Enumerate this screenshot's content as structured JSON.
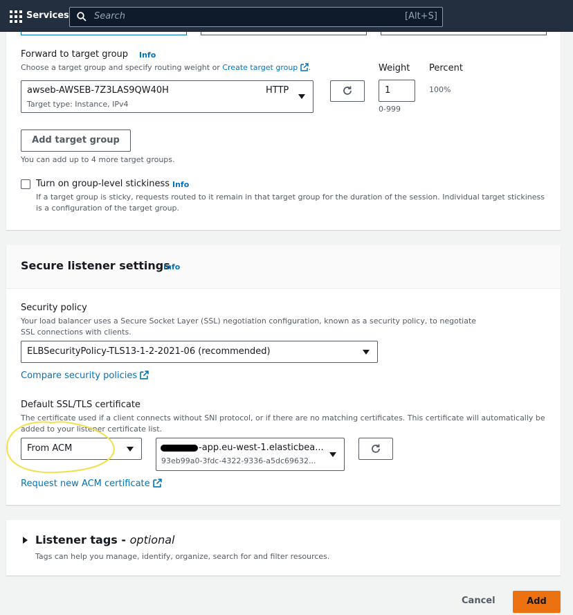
{
  "topbar": {
    "services_label": "Services",
    "search_placeholder": "Search",
    "search_shortcut": "[Alt+S]"
  },
  "forward": {
    "label": "Forward to target group",
    "info": "Info",
    "description": "Choose a target group and specify routing weight or",
    "create_link": "Create target group",
    "target_group_name": "awseb-AWSEB-7Z3LAS9QW40H",
    "target_group_protocol": "HTTP",
    "target_group_type": "Target type: Instance, IPv4",
    "weight_label": "Weight",
    "weight_value": "1",
    "weight_range": "0-999",
    "percent_label": "Percent",
    "percent_value": "100%",
    "add_button": "Add target group",
    "add_hint": "You can add up to 4 more target groups.",
    "stickiness_label": "Turn on group-level stickiness",
    "stickiness_info": "Info",
    "stickiness_desc": "If a target group is sticky, requests routed to it remain in that target group for the duration of the session. Individual target stickiness is a configuration of the target group."
  },
  "secure": {
    "title": "Secure listener settings",
    "info": "Info",
    "policy_label": "Security policy",
    "policy_desc": "Your load balancer uses a Secure Socket Layer (SSL) negotiation configuration, known as a security policy, to negotiate SSL connections with clients.",
    "policy_value": "ELBSecurityPolicy-TLS13-1-2-2021-06 (recommended)",
    "compare_link": "Compare security policies",
    "cert_label": "Default SSL/TLS certificate",
    "cert_desc": "The certificate used if a client connects without SNI protocol, or if there are no matching certificates. This certificate will automatically be added to your listener certificate list.",
    "cert_source": "From ACM",
    "cert_name": "-app.eu-west-1.elasticbea...",
    "cert_id": "93eb99a0-3fdc-4322-9336-a5dc69632...",
    "request_link": "Request new ACM certificate"
  },
  "tags": {
    "title": "Listener tags -",
    "optional": "optional",
    "desc": "Tags can help you manage, identify, organize, search for and filter resources."
  },
  "footer": {
    "cancel": "Cancel",
    "add": "Add"
  },
  "colors": {
    "accent": "#ec7211",
    "link": "#0073bb",
    "highlight": "#f2df4a"
  }
}
